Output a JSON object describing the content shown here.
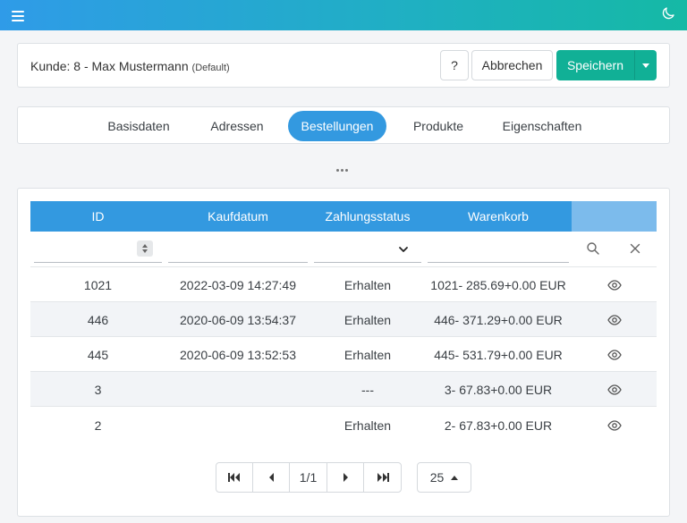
{
  "header": {
    "customer_label": "Kunde: 8 - Max Mustermann",
    "customer_tag": "(Default)",
    "help_label": "?",
    "cancel_label": "Abbrechen",
    "save_label": "Speichern"
  },
  "tabs": [
    {
      "label": "Basisdaten",
      "active": false
    },
    {
      "label": "Adressen",
      "active": false
    },
    {
      "label": "Bestellungen",
      "active": true
    },
    {
      "label": "Produkte",
      "active": false
    },
    {
      "label": "Eigenschaften",
      "active": false
    }
  ],
  "table": {
    "columns": [
      "ID",
      "Kaufdatum",
      "Zahlungsstatus",
      "Warenkorb"
    ],
    "rows": [
      {
        "id": "1021",
        "date": "2022-03-09 14:27:49",
        "status": "Erhalten",
        "cart": "1021- 285.69+0.00 EUR"
      },
      {
        "id": "446",
        "date": "2020-06-09 13:54:37",
        "status": "Erhalten",
        "cart": "446- 371.29+0.00 EUR"
      },
      {
        "id": "445",
        "date": "2020-06-09 13:52:53",
        "status": "Erhalten",
        "cart": "445- 531.79+0.00 EUR"
      },
      {
        "id": "3",
        "date": "",
        "status": "---",
        "cart": "3- 67.83+0.00 EUR"
      },
      {
        "id": "2",
        "date": "",
        "status": "Erhalten",
        "cart": "2- 67.83+0.00 EUR"
      }
    ]
  },
  "pagination": {
    "page_info": "1/1",
    "page_size": "25"
  },
  "icons": {
    "menu": "hamburger-icon",
    "theme": "moon-icon",
    "search": "search-icon",
    "clear": "close-icon",
    "view": "eye-icon"
  },
  "colors": {
    "primary": "#3399e0",
    "save": "#11b096"
  }
}
